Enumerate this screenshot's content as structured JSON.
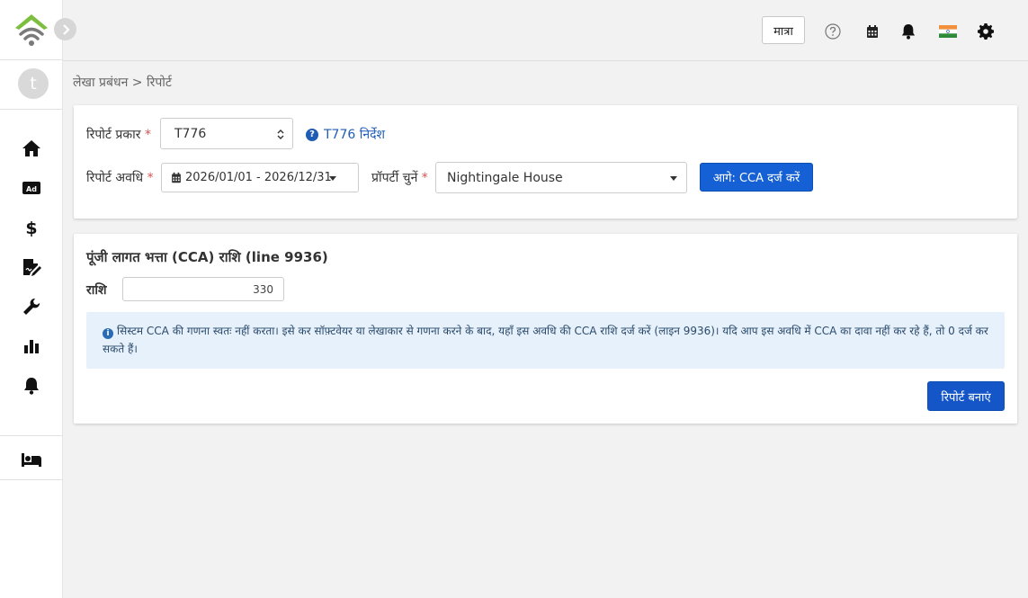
{
  "topbar": {
    "unit_label": "मात्रा"
  },
  "sidebar": {
    "avatar_initial": "t",
    "items": [
      {
        "icon": "home-icon"
      },
      {
        "icon": "ad-icon",
        "text": "Ad"
      },
      {
        "icon": "dollar-icon",
        "text": "$"
      },
      {
        "icon": "edit-document-icon"
      },
      {
        "icon": "wrench-icon"
      },
      {
        "icon": "bar-chart-icon"
      },
      {
        "icon": "bell-icon"
      },
      {
        "icon": "bed-icon"
      }
    ]
  },
  "breadcrumb": {
    "text": "लेखा प्रबंधन > रिपोर्ट"
  },
  "filters": {
    "report_type_label": "रिपोर्ट प्रकार",
    "report_type_value": "T776",
    "required_mark": "*",
    "help_link": "T776 निर्देश",
    "period_label": "रिपोर्ट अवधि",
    "period_value": "2026/01/01 - 2026/12/31",
    "property_label": "प्रॉपर्टी चुनें",
    "property_value": "Nightingale House",
    "next_button": "आगे: CCA दर्ज करें"
  },
  "cca": {
    "title": "पूंजी लागत भत्ता (CCA) राशि  (line 9936)",
    "amount_label": "राशि",
    "amount_value": "330",
    "info_text": "सिस्टम CCA की गणना स्वतः नहीं करता। इसे कर सॉफ़्टवेयर या लेखाकार से गणना करने के बाद, यहाँ इस अवधि की CCA राशि दर्ज करें (लाइन 9936)। यदि आप इस अवधि में CCA का दावा नहीं कर रहे हैं, तो 0 दर्ज कर सकते हैं।",
    "generate_button": "रिपोर्ट बनाएं"
  },
  "colors": {
    "primary": "#1460d4",
    "link": "#1f5db5",
    "logo_green": "#7cbf3f",
    "required": "#d9534f",
    "info_bg": "#e7f1fb"
  }
}
